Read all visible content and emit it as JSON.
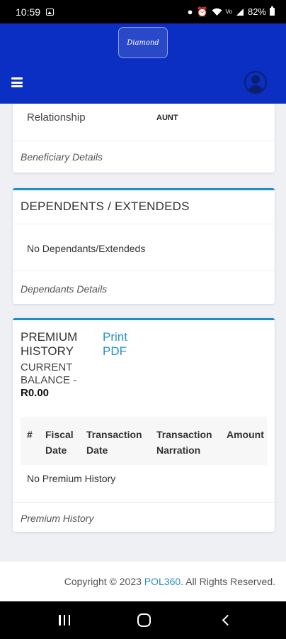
{
  "status_bar": {
    "time": "10:59",
    "battery": "82%",
    "icons": [
      "image-icon",
      "lock-icon",
      "alarm-icon",
      "wifi-icon",
      "volte-icon",
      "signal-icon",
      "battery-icon"
    ]
  },
  "header": {
    "logo_text": "Diamond",
    "menu_icon": "hamburger-icon",
    "profile_icon": "user-avatar-icon",
    "background_color": "#0a2fc2"
  },
  "beneficiary_card": {
    "relationship_label": "Relationship",
    "relationship_value": "AUNT",
    "footer": "Beneficiary Details"
  },
  "dependents_card": {
    "title": "DEPENDENTS / EXTENDEDS",
    "empty_text": "No Dependants/Extendeds",
    "footer": "Dependants Details",
    "accent_color": "#1c8fc6"
  },
  "premium_card": {
    "title": "PREMIUM HISTORY",
    "balance_label": "CURRENT BALANCE -",
    "balance_value": "R0.00",
    "print_link": "Print PDF",
    "columns": [
      "#",
      "Fiscal Date",
      "Transaction Date",
      "Transaction Narration",
      "Amount"
    ],
    "empty_text": "No Premium History",
    "footer": "Premium History"
  },
  "footer": {
    "prefix": "Copyright © 2023 ",
    "brand": "POL360",
    "suffix": ". All Rights Reserved."
  },
  "nav_bar": {
    "icons": [
      "recents-icon",
      "home-icon",
      "back-icon"
    ]
  }
}
